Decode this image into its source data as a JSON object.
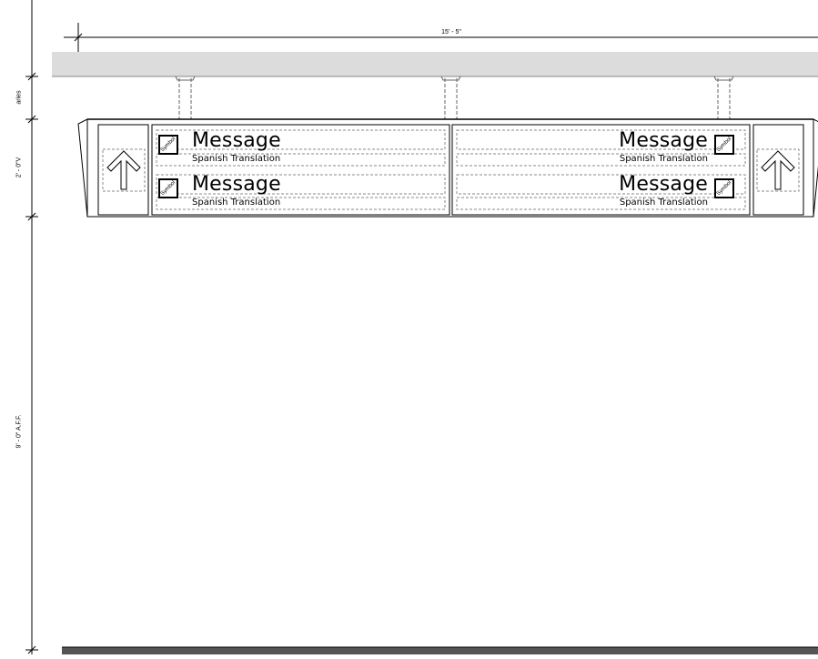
{
  "dimensions": {
    "overall_width": "15' - 5\"",
    "clearance_label": "aries",
    "sign_height": "2' - 0\"V",
    "mount_height": "9' - 0\" A.F.F."
  },
  "sign": {
    "left_panel": {
      "rows": [
        {
          "message": "Message",
          "translation": "Spanish Translation",
          "symbol": "Symbol"
        },
        {
          "message": "Message",
          "translation": "Spanish Translation",
          "symbol": "Symbol"
        }
      ]
    },
    "right_panel": {
      "rows": [
        {
          "message": "Message",
          "translation": "Spanish Translation",
          "symbol": "Symbol"
        },
        {
          "message": "Message",
          "translation": "Spanish Translation",
          "symbol": "Symbol"
        }
      ]
    },
    "arrows": [
      "arrow-up-icon",
      "arrow-up-icon"
    ]
  }
}
